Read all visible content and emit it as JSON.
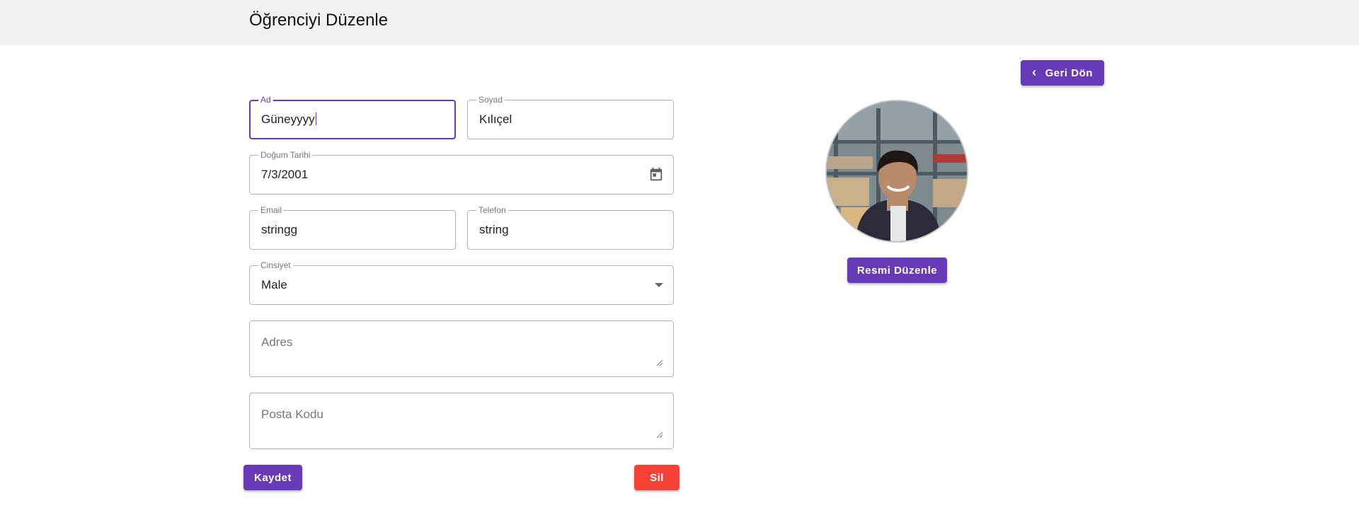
{
  "header": {
    "title": "Öğrenciyi Düzenle"
  },
  "actions": {
    "back_label": "Geri Dön",
    "edit_photo_label": "Resmi Düzenle",
    "save_label": "Kaydet",
    "delete_label": "Sil"
  },
  "form": {
    "first_name": {
      "label": "Ad",
      "value": "Güneyyyy"
    },
    "last_name": {
      "label": "Soyad",
      "value": "Kılıçel"
    },
    "birth_date": {
      "label": "Doğum Tarihi",
      "value": "7/3/2001"
    },
    "email": {
      "label": "Email",
      "value": "stringg"
    },
    "phone": {
      "label": "Telefon",
      "value": "string"
    },
    "gender": {
      "label": "Cinsiyet",
      "value": "Male"
    },
    "address": {
      "placeholder": "Adres",
      "value": ""
    },
    "postal_code": {
      "placeholder": "Posta Kodu",
      "value": ""
    }
  },
  "colors": {
    "primary": "#673ab7",
    "danger": "#f44336",
    "header_bg": "#f1f1f1"
  },
  "icons": {
    "back": "chevron-left-icon",
    "calendar": "calendar-icon",
    "dropdown": "dropdown-arrow-icon"
  }
}
